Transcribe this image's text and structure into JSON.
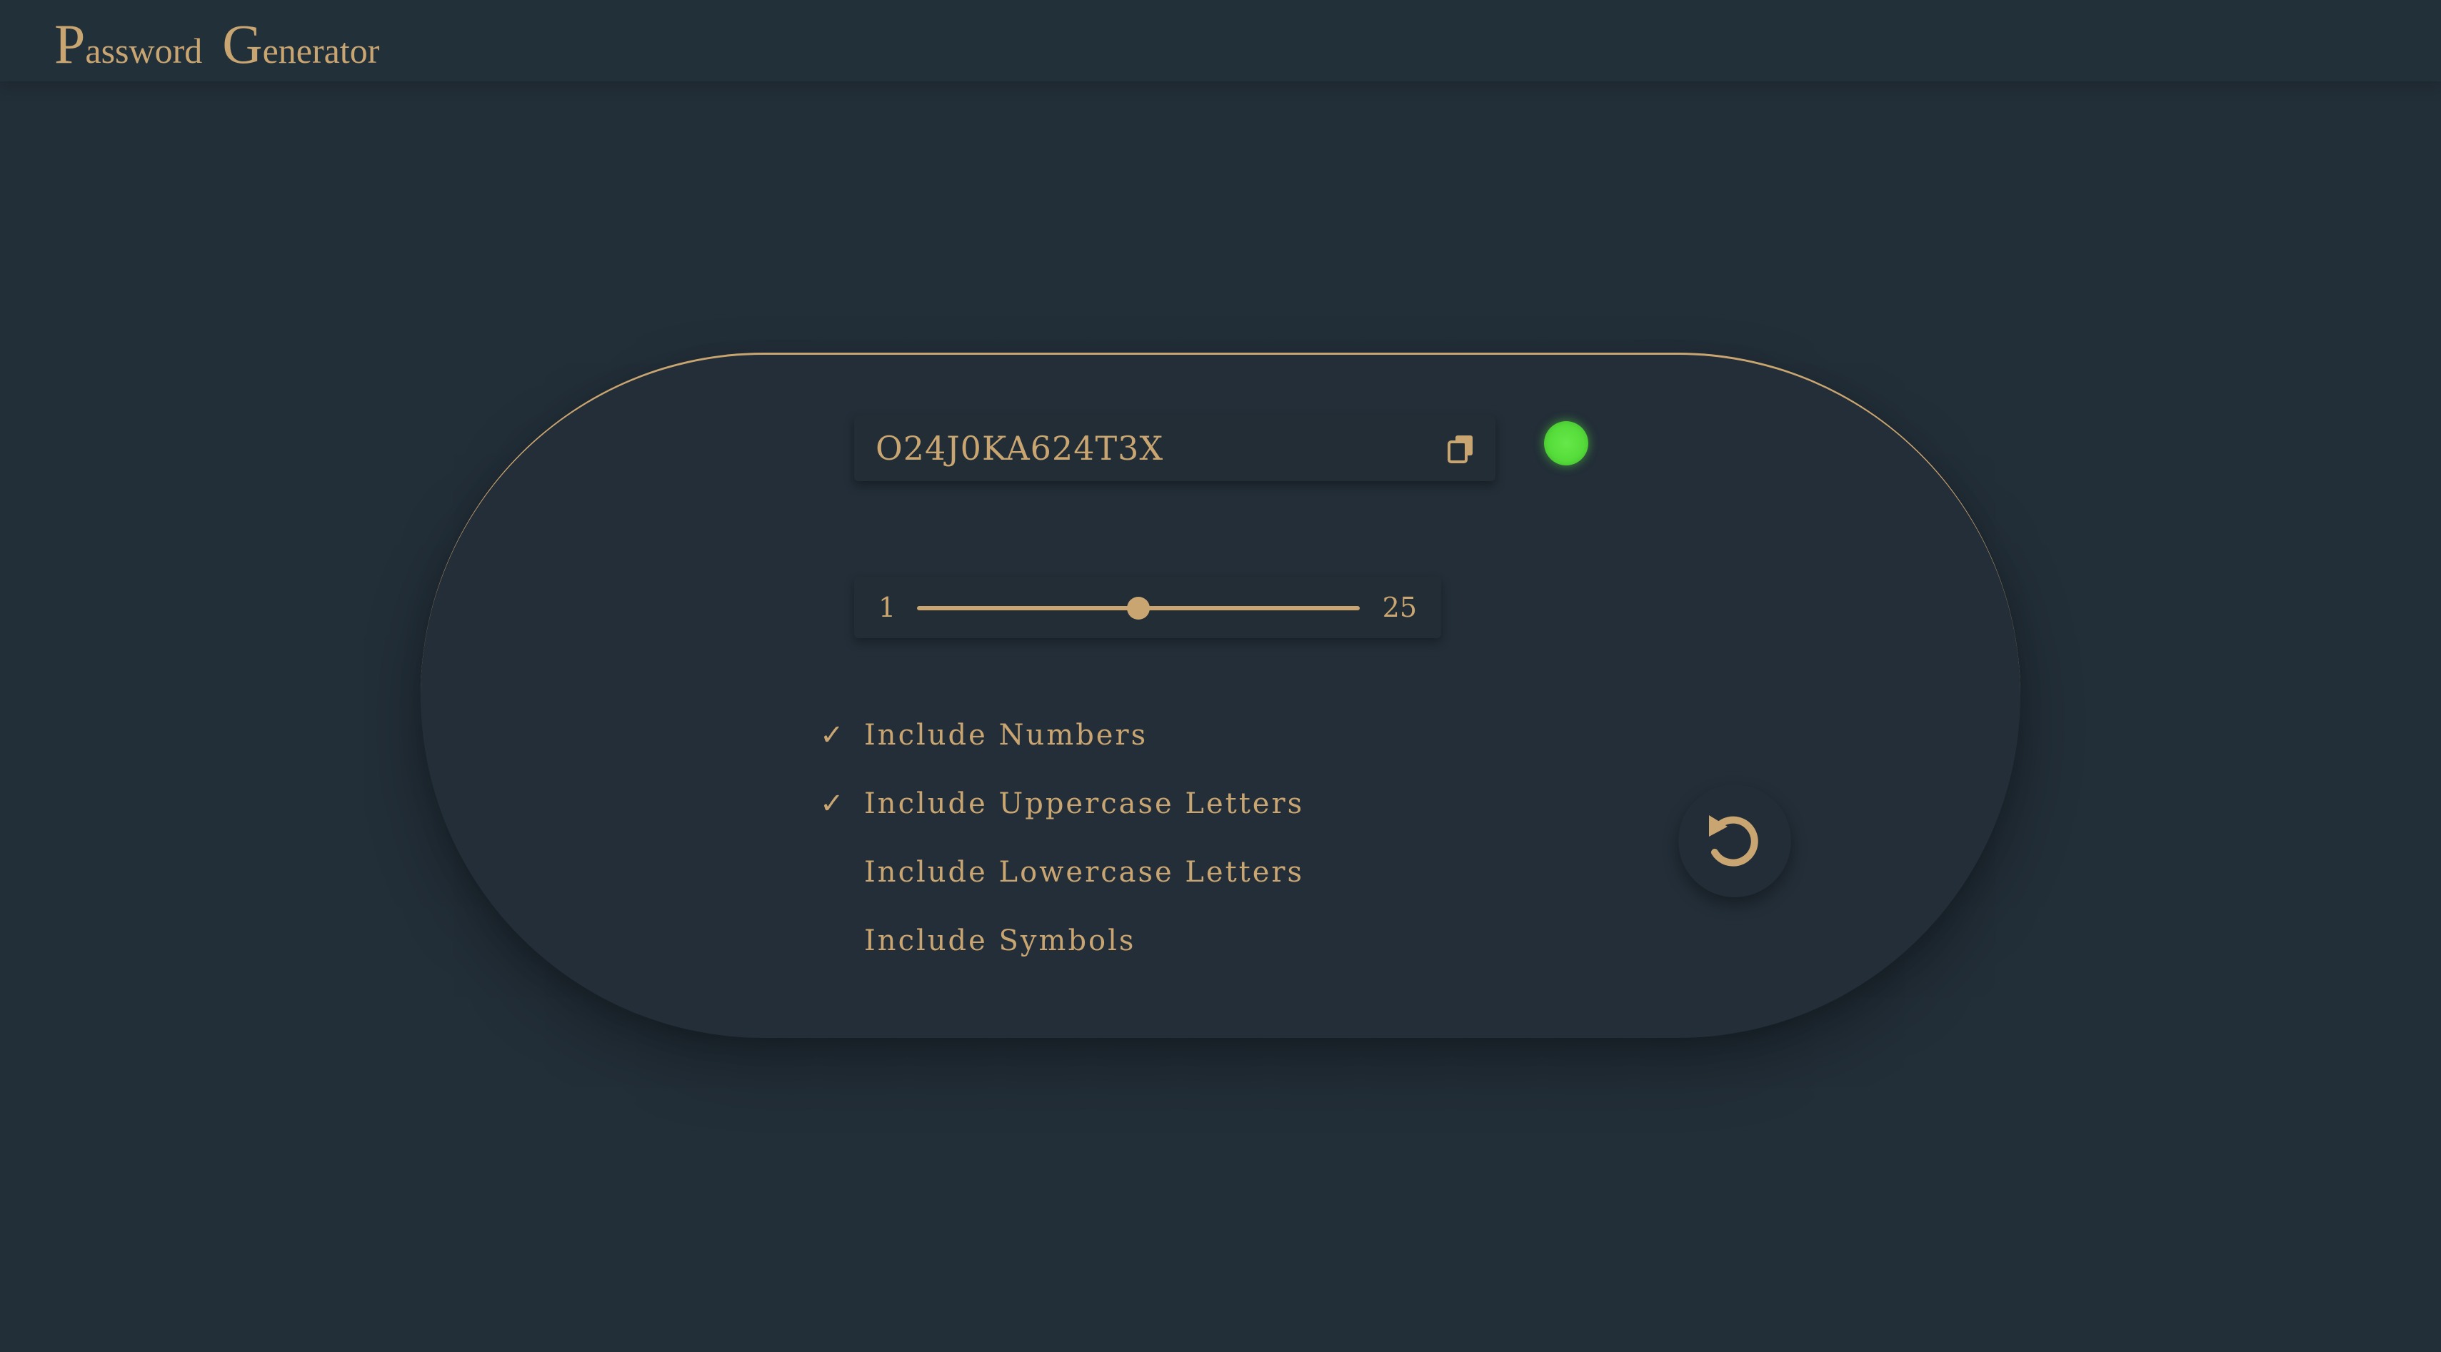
{
  "header": {
    "title_word1_initial": "P",
    "title_word1_rest": "assword",
    "title_word2_initial": "G",
    "title_word2_rest": "enerator"
  },
  "generator": {
    "password": "O24J0KA624T3X",
    "copy_icon": "copy-icon",
    "status_color": "#55dc3a"
  },
  "length_slider": {
    "min_label": "1",
    "max_label": "25",
    "value_fraction": 0.5
  },
  "options": [
    {
      "label": "Include Numbers",
      "checked": true
    },
    {
      "label": "Include Uppercase Letters",
      "checked": true
    },
    {
      "label": "Include Lowercase Letters",
      "checked": false
    },
    {
      "label": "Include Symbols",
      "checked": false
    }
  ],
  "check_mark": "✓",
  "refresh_icon": "refresh-icon",
  "colors": {
    "accent": "#c9a571",
    "background": "#222e38"
  }
}
